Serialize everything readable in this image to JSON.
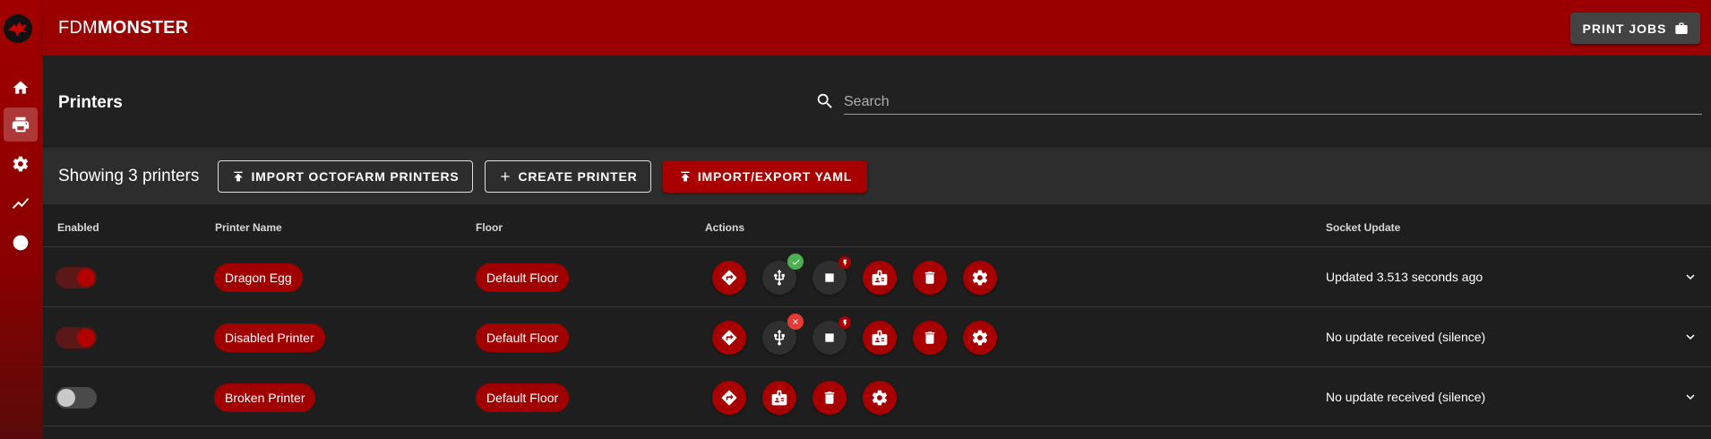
{
  "app": {
    "brand_light": "FDM",
    "brand_bold": "MONSTER",
    "print_jobs_label": "PRINT JOBS"
  },
  "nav": [
    {
      "icon": "home-icon"
    },
    {
      "icon": "printer-icon",
      "active": true
    },
    {
      "icon": "gear-icon"
    },
    {
      "icon": "trend-chart-icon"
    },
    {
      "icon": "help-icon"
    }
  ],
  "page": {
    "title": "Printers",
    "search_placeholder": "Search"
  },
  "toolbar": {
    "count_text": "Showing 3 printers",
    "import_octofarm": "IMPORT OCTOFARM PRINTERS",
    "create_printer": "CREATE PRINTER",
    "import_export_yaml": "IMPORT/EXPORT YAML"
  },
  "table": {
    "headers": {
      "enabled": "Enabled",
      "name": "Printer Name",
      "floor": "Floor",
      "actions": "Actions",
      "socket": "Socket Update"
    },
    "rows": [
      {
        "enabled": true,
        "name": "Dragon Egg",
        "floor": "Default Floor",
        "socket": "Updated 3.513 seconds ago",
        "connection_status": "connected"
      },
      {
        "enabled": true,
        "name": "Disabled Printer",
        "floor": "Default Floor",
        "socket": "No update received (silence)",
        "connection_status": "error"
      },
      {
        "enabled": false,
        "name": "Broken Printer",
        "floor": "Default Floor",
        "socket": "No update received (silence)",
        "connection_status": "none"
      }
    ]
  },
  "colors": {
    "brand_red": "#9b0000",
    "accent_red": "#a80000",
    "success_green": "#4caf50",
    "error_red": "#e53935",
    "background": "#1e1e1e"
  }
}
